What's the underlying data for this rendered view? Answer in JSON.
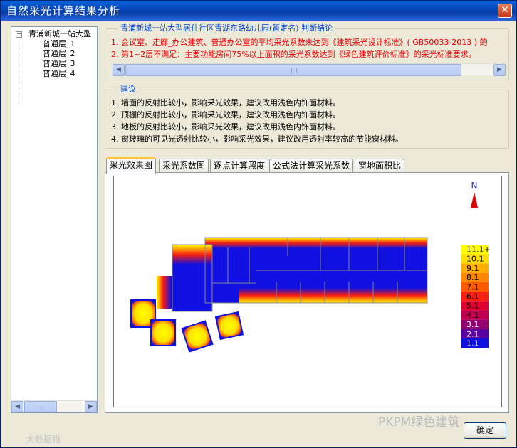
{
  "window": {
    "title": "自然采光计算结果分析",
    "close_glyph": "✕"
  },
  "tree": {
    "root_label": "青浦新城一站大型",
    "toggle_glyph": "−",
    "children": [
      "普通层_1",
      "普通层_2",
      "普通层_3",
      "普通层_4"
    ]
  },
  "conclusion": {
    "title": "青浦新城一站大型居住社区青湖东路幼儿园(暂定名) 判断结论",
    "lines": [
      "1.  会议室、走廊_办公建筑、普通办公室的平均采光系数未达到《建筑采光设计标准》( GB50033-2013 ) 的",
      "2.  第1~2层不满足：主要功能房间75%以上面积的采光系数达到《绿色建筑评价标准》的采光标准要求。"
    ]
  },
  "suggestion": {
    "title": "建议",
    "lines": [
      "1.  墙面的反射比较小，影响采光效果，建议改用浅色内饰面材料。",
      "2.  顶棚的反射比较小，影响采光效果，建议改用浅色内饰面材料。",
      "3.  地板的反射比较小，影响采光效果，建议改用浅色内饰面材料。",
      "4.  窗玻璃的可见光透射比较小，影响采光效果，建议改用透射率较高的节能窗材料。"
    ]
  },
  "tabs": [
    {
      "label": "采光效果图",
      "active": true
    },
    {
      "label": "采光系数图",
      "active": false
    },
    {
      "label": "逐点计算照度",
      "active": false
    },
    {
      "label": "公式法计算采光系数",
      "active": false
    },
    {
      "label": "窗地面积比",
      "active": false
    }
  ],
  "map": {
    "north_label": "N",
    "legend": [
      {
        "label": "11.1+",
        "color": "#ffff00"
      },
      {
        "label": "10.1",
        "color": "#ffe000"
      },
      {
        "label": "9.1",
        "color": "#ffb000"
      },
      {
        "label": "8.1",
        "color": "#ff8800"
      },
      {
        "label": "7.1",
        "color": "#ff5a00"
      },
      {
        "label": "6.1",
        "color": "#f82010"
      },
      {
        "label": "5.1",
        "color": "#e00030"
      },
      {
        "label": "4.1",
        "color": "#c00050"
      },
      {
        "label": "3.1",
        "color": "#900070"
      },
      {
        "label": "2.1",
        "color": "#5a00a0"
      },
      {
        "label": "1.1",
        "color": "#1010e0"
      }
    ]
  },
  "buttons": {
    "ok": "确定"
  },
  "watermarks": {
    "right": "PKPM绿色建筑",
    "left": "大数据猎"
  }
}
